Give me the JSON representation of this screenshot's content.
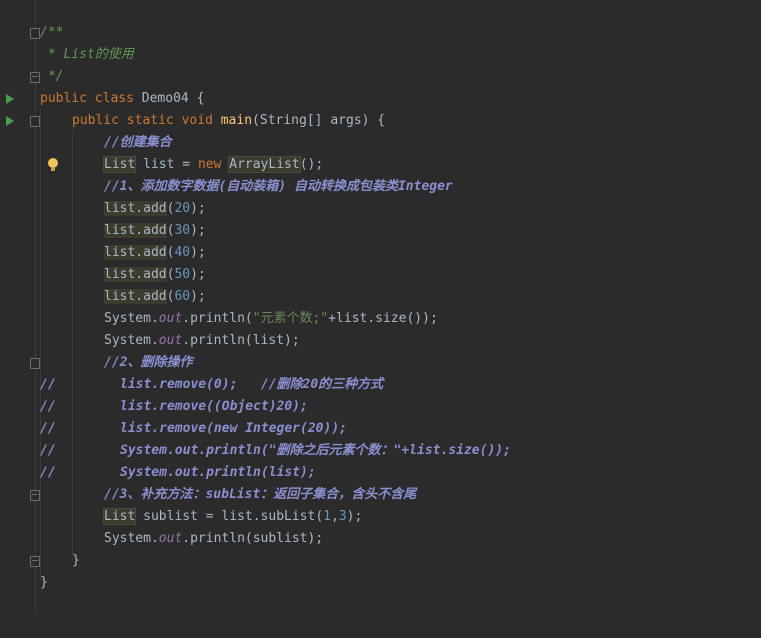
{
  "lines": [
    {
      "t": "/**"
    },
    {
      "t": " * List的使用"
    },
    {
      "t": " */"
    },
    {
      "p": [
        "public",
        "class",
        "Demo04",
        "{"
      ]
    },
    {
      "p": [
        "public",
        "static",
        "void",
        "main",
        "(String[] args) {"
      ]
    },
    {
      "t": "//创建集合"
    },
    {
      "p": [
        "List",
        " list = ",
        "new",
        "ArrayList",
        "();"
      ]
    },
    {
      "t": "//1、添加数字数据(自动装箱) 自动转换成包装类Integer"
    },
    {
      "p": [
        "list.add",
        "(",
        "20",
        ");"
      ]
    },
    {
      "p": [
        "list.add",
        "(",
        "30",
        ");"
      ]
    },
    {
      "p": [
        "list.add",
        "(",
        "40",
        ");"
      ]
    },
    {
      "p": [
        "list.add",
        "(",
        "50",
        ");"
      ]
    },
    {
      "p": [
        "list.add",
        "(",
        "60",
        ");"
      ]
    },
    {
      "p": [
        "System.",
        "out",
        ".println(",
        "\"元素个数;\"",
        "+list.size());"
      ]
    },
    {
      "p": [
        "System.",
        "out",
        ".println(list);"
      ]
    },
    {
      "t": "//2、删除操作"
    },
    {
      "p": [
        "//",
        "list.remove(0);   //删除20的三种方式"
      ]
    },
    {
      "p": [
        "//",
        "list.remove((Object)20);"
      ]
    },
    {
      "p": [
        "//",
        "list.remove(new Integer(20));"
      ]
    },
    {
      "p": [
        "//",
        "System.out.println(\"删除之后元素个数：\"+list.size());"
      ]
    },
    {
      "p": [
        "//",
        "System.out.println(list);"
      ]
    },
    {
      "t": "//3、补充方法：subList：返回子集合，含头不含尾"
    },
    {
      "p": [
        "List",
        " sublist = list.subList(",
        "1",
        ",",
        "3",
        ");"
      ]
    },
    {
      "p": [
        "System.",
        "out",
        ".println(sublist);"
      ]
    },
    {
      "t": "}"
    },
    {
      "t": "}"
    }
  ],
  "colors": {
    "background": "#2b2b2b",
    "keyword": "#cc7832",
    "function": "#ffc66d",
    "number": "#6897bb",
    "string": "#6a8759",
    "doc_comment": "#629755",
    "line_comment": "#8a8fcf",
    "default_text": "#a9b7c6",
    "run_icon": "#499c54",
    "bulb_icon": "#f2c55c"
  },
  "icons": [
    "run-icon",
    "fold-icon",
    "lightbulb-icon"
  ]
}
